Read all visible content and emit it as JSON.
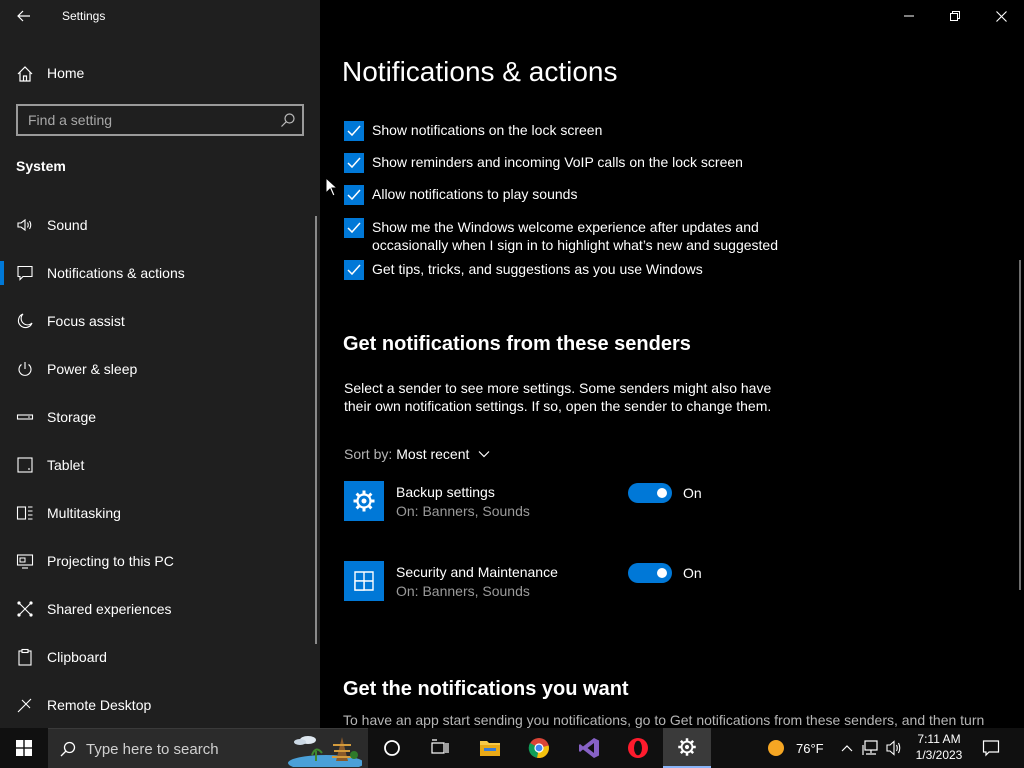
{
  "window": {
    "app_title": "Settings"
  },
  "sidebar": {
    "home_label": "Home",
    "search_placeholder": "Find a setting",
    "section_title": "System",
    "items": [
      {
        "label": "Sound",
        "icon": "speaker-icon"
      },
      {
        "label": "Notifications & actions",
        "icon": "message-icon",
        "active": true
      },
      {
        "label": "Focus assist",
        "icon": "moon-icon"
      },
      {
        "label": "Power & sleep",
        "icon": "power-icon"
      },
      {
        "label": "Storage",
        "icon": "storage-icon"
      },
      {
        "label": "Tablet",
        "icon": "tablet-icon"
      },
      {
        "label": "Multitasking",
        "icon": "multitasking-icon"
      },
      {
        "label": "Projecting to this PC",
        "icon": "projecting-icon"
      },
      {
        "label": "Shared experiences",
        "icon": "shared-experiences-icon"
      },
      {
        "label": "Clipboard",
        "icon": "clipboard-icon"
      },
      {
        "label": "Remote Desktop",
        "icon": "remote-desktop-icon"
      }
    ]
  },
  "main": {
    "page_title": "Notifications & actions",
    "checkboxes": [
      {
        "label": "Show notifications on the lock screen",
        "checked": true
      },
      {
        "label": "Show reminders and incoming VoIP calls on the lock screen",
        "checked": true
      },
      {
        "label": "Allow notifications to play sounds",
        "checked": true
      },
      {
        "label": "Show me the Windows welcome experience after updates and occasionally when I sign in to highlight what’s new and suggested",
        "checked": true
      },
      {
        "label": "Get tips, tricks, and suggestions as you use Windows",
        "checked": true
      }
    ],
    "senders_heading": "Get notifications from these senders",
    "senders_desc": "Select a sender to see more settings. Some senders might also have their own notification settings. If so, open the sender to change them.",
    "sort_label": "Sort by:",
    "sort_value": "Most recent",
    "senders": [
      {
        "name": "Backup settings",
        "detail": "On: Banners, Sounds",
        "state": "On",
        "icon": "gear-icon"
      },
      {
        "name": "Security and Maintenance",
        "detail": "On: Banners, Sounds",
        "state": "On",
        "icon": "security-maintenance-icon"
      }
    ],
    "want_heading": "Get the notifications you want",
    "want_text": "To have an app start sending you notifications, go to Get notifications from these senders, and then turn"
  },
  "taskbar": {
    "search_placeholder": "Type here to search",
    "weather": "76°F",
    "time": "7:11 AM",
    "date": "1/3/2023"
  },
  "colors": {
    "accent": "#0078d7",
    "sidebar_bg": "#1f1f1f",
    "content_bg": "#000000"
  }
}
